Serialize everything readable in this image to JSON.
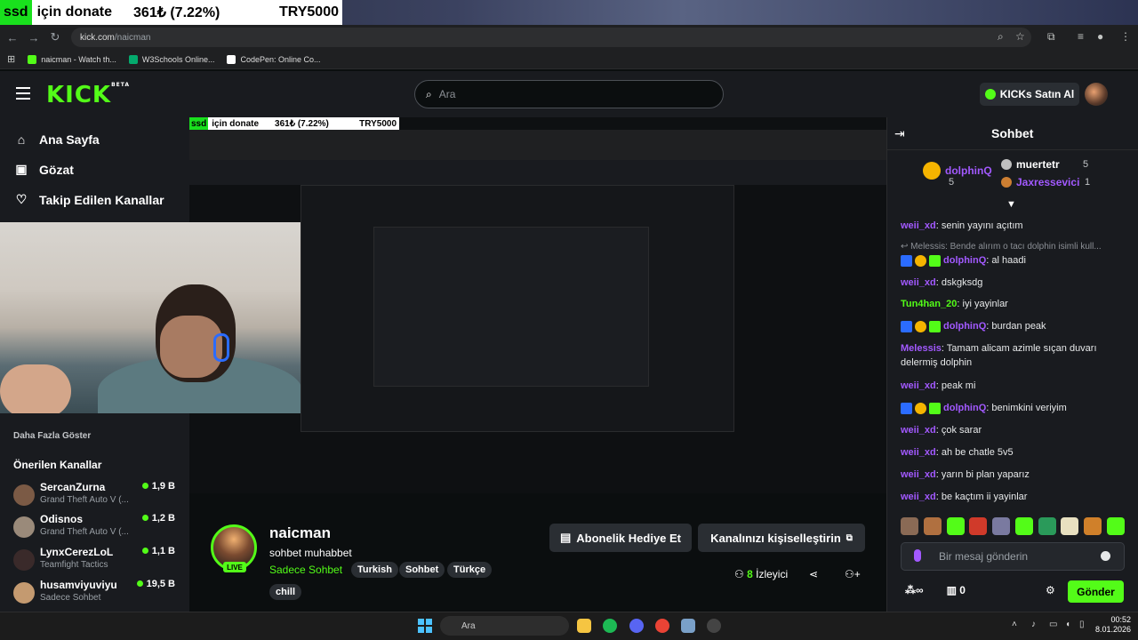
{
  "donate": {
    "ssd": "ssd",
    "text": "için donate",
    "amount": "361₺ (7.22%)",
    "currency": "TRY5000"
  },
  "browser": {
    "url_domain": "kick.com",
    "url_path": "/naicman",
    "bookmarks": [
      {
        "label": "naicman - Watch th...",
        "color": "#53fc18"
      },
      {
        "label": "W3Schools Online...",
        "color": "#04aa6d"
      },
      {
        "label": "CodePen: Online Co...",
        "color": "#ffffff"
      }
    ]
  },
  "header": {
    "logo": "KICK",
    "logo_sup": "BETA",
    "search_placeholder": "Ara",
    "buy_label": "KICKs Satın Al"
  },
  "sidebar": {
    "nav": [
      {
        "label": "Ana Sayfa",
        "icon": "home-icon"
      },
      {
        "label": "Gözat",
        "icon": "browse-icon"
      },
      {
        "label": "Takip Edilen Kanallar",
        "icon": "heart-icon"
      }
    ],
    "more_label": "Daha Fazla Göster",
    "recommended_title": "Önerilen Kanallar",
    "recommended": [
      {
        "name": "SercanZurna",
        "game": "Grand Theft Auto V (...",
        "viewers": "1,9 B",
        "color": "#7b5a45"
      },
      {
        "name": "Odisnos",
        "game": "Grand Theft Auto V (...",
        "viewers": "1,2 B",
        "color": "#9a8a7a"
      },
      {
        "name": "LynxCerezLoL",
        "game": "Teamfight Tactics",
        "viewers": "1,1 B",
        "color": "#3a2a2a"
      },
      {
        "name": "husamviyuviyu",
        "game": "Sadece Sohbet",
        "viewers": "19,5 B",
        "color": "#c49a70"
      }
    ]
  },
  "stream": {
    "channel": "naicman",
    "title": "sohbet muhabbet",
    "category": "Sadece Sohbet",
    "live": "LIVE",
    "tags": [
      "Turkish",
      "Sohbet",
      "Türkçe",
      "chill"
    ],
    "gift_button": "Abonelik Hediye Et",
    "customize_button": "Kanalınızı kişiselleştirin",
    "viewer_count": "8",
    "viewer_label": "İzleyici"
  },
  "chat": {
    "title": "Sohbet",
    "gifters": [
      {
        "name": "dolphinQ",
        "count": "5",
        "color": "#a259ff",
        "medal": "#f5b400"
      },
      {
        "name": "muertetr",
        "count": "5",
        "color": "#ffffff",
        "medal": "#c0c0c0"
      },
      {
        "name": "Jaxressevici",
        "count": "1",
        "color": "#a259ff",
        "medal": "#cd7f32"
      }
    ],
    "messages": [
      {
        "user": "weii_xd",
        "color": "#a259ff",
        "text": "senin yayını açıtım",
        "badges": false
      },
      {
        "reply": "Melessis: Bende alırım o tacı dolphin isimli kull...",
        "user": "dolphinQ",
        "color": "#a259ff",
        "text": "al haadi",
        "badges": true
      },
      {
        "user": "weii_xd",
        "color": "#a259ff",
        "text": "dskgksdg",
        "badges": false
      },
      {
        "user": "Tun4han_20",
        "color": "#53fc18",
        "text": "iyi yayinlar",
        "badges": false
      },
      {
        "user": "dolphinQ",
        "color": "#a259ff",
        "text": "burdan peak",
        "badges": true
      },
      {
        "user": "Melessis",
        "color": "#a259ff",
        "text": "Tamam alicam azimle sıçan duvarı delermiş dolphin",
        "badges": false
      },
      {
        "user": "weii_xd",
        "color": "#a259ff",
        "text": "peak mi",
        "badges": false
      },
      {
        "user": "dolphinQ",
        "color": "#a259ff",
        "text": "benimkini veriyim",
        "badges": true
      },
      {
        "user": "weii_xd",
        "color": "#a259ff",
        "text": "çok sarar",
        "badges": false
      },
      {
        "user": "weii_xd",
        "color": "#a259ff",
        "text": "ah be chatle 5v5",
        "badges": false
      },
      {
        "user": "weii_xd",
        "color": "#a259ff",
        "text": "yarın bi plan yaparız",
        "badges": false
      },
      {
        "user": "weii_xd",
        "color": "#a259ff",
        "text": "be kaçtım ii yayinlar",
        "badges": false
      }
    ],
    "emotes": [
      "#8a6a55",
      "#b07040",
      "#53fc18",
      "#d03a2a",
      "#7a7aa0",
      "#53fc18",
      "#2a9a5a",
      "#e8e0c0",
      "#d0802a",
      "#53fc18"
    ],
    "input_placeholder": "Bir mesaj gönderin",
    "points": "0",
    "send_label": "Gönder"
  },
  "taskbar": {
    "search_placeholder": "Ara",
    "time": "00:52",
    "date": "8.01.2026",
    "apps": [
      {
        "icon": "folder-icon",
        "color": "#f5c542"
      },
      {
        "icon": "spotify-icon",
        "color": "#1db954"
      },
      {
        "icon": "discord-icon",
        "color": "#5865f2"
      },
      {
        "icon": "chrome-icon",
        "color": "#ea4335"
      },
      {
        "icon": "app-icon",
        "color": "#7aa0c8"
      },
      {
        "icon": "obs-icon",
        "color": "#444444"
      }
    ]
  }
}
